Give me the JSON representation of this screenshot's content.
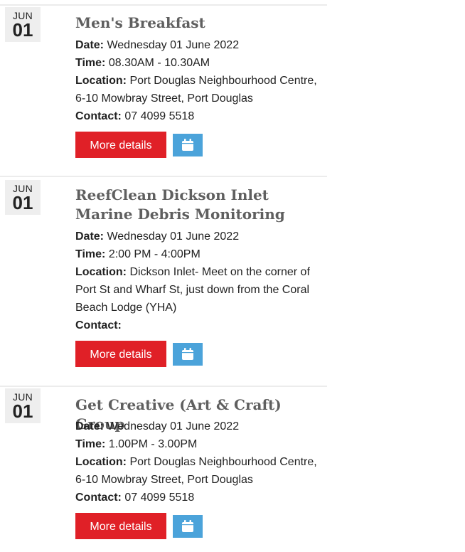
{
  "events": [
    {
      "month": "JUN",
      "day": "01",
      "title": "Men's Breakfast",
      "date_label": "Date:",
      "date_value": " Wednesday 01 June 2022",
      "time_label": "Time:",
      "time_value": " 08.30AM - 10.30AM",
      "location_label": "Location:",
      "location_value": " Port Douglas Neighbourhood Centre, 6-10 Mowbray Street, Port Douglas",
      "contact_label": "Contact:",
      "contact_value": " 07 4099 5518",
      "more_label": "More details",
      "calendar_icon": "calendar-icon"
    },
    {
      "month": "JUN",
      "day": "01",
      "title": "ReefClean Dickson Inlet Marine Debris Monitoring",
      "date_label": "Date:",
      "date_value": " Wednesday 01 June 2022",
      "time_label": "Time:",
      "time_value": " 2:00 PM - 4:00PM",
      "location_label": "Location:",
      "location_value": " Dickson Inlet- Meet on the corner of Port St and Wharf St, just down from the Coral Beach Lodge (YHA)",
      "contact_label": "Contact:",
      "contact_value": "",
      "more_label": "More details",
      "calendar_icon": "calendar-icon"
    },
    {
      "month": "JUN",
      "day": "01",
      "title": "Get Creative (Art & Craft) Group",
      "date_label": "Date:",
      "date_value": " Wednesday 01 June 2022",
      "time_label": "Time:",
      "time_value": " 1.00PM - 3.00PM",
      "location_label": "Location:",
      "location_value": " Port Douglas Neighbourhood Centre, 6-10 Mowbray Street, Port Douglas",
      "contact_label": "Contact:",
      "contact_value": " 07 4099 5518",
      "more_label": "More details",
      "calendar_icon": "calendar-icon"
    }
  ],
  "colors": {
    "button_red": "#e02027",
    "calendar_blue": "#4ba3da",
    "title_gray": "#5f5f5f",
    "badge_bg": "#eeeeee"
  }
}
